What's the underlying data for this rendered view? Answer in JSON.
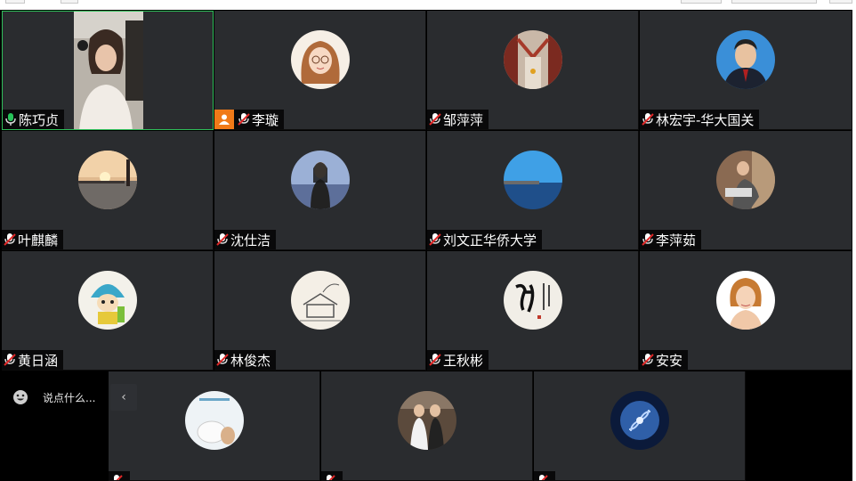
{
  "chat": {
    "placeholder": "说点什么...",
    "smile_icon": "smile-icon",
    "collapse_icon": "chevron-left-icon"
  },
  "colors": {
    "tile_bg": "#2a2c2f",
    "active_border": "#2fbe5a",
    "host_badge": "#f07a18",
    "mic": "#e02828"
  },
  "participants": [
    {
      "name": "陈巧贞",
      "mic": "on",
      "video": true
    },
    {
      "name": "李璇",
      "mic": "muted",
      "host": true
    },
    {
      "name": "邹萍萍",
      "mic": "muted"
    },
    {
      "name": "林宏宇-华大国关",
      "mic": "muted"
    },
    {
      "name": "叶麒麟",
      "mic": "muted"
    },
    {
      "name": "沈仕洁",
      "mic": "muted"
    },
    {
      "name": "刘文正华侨大学",
      "mic": "muted"
    },
    {
      "name": "李萍茹",
      "mic": "muted"
    },
    {
      "name": "黄日涵",
      "mic": "muted"
    },
    {
      "name": "林俊杰",
      "mic": "muted"
    },
    {
      "name": "王秋彬",
      "mic": "muted"
    },
    {
      "name": "安安",
      "mic": "muted"
    },
    {
      "name": "",
      "mic": "muted"
    },
    {
      "name": "",
      "mic": "muted"
    },
    {
      "name": "",
      "mic": "muted"
    }
  ]
}
